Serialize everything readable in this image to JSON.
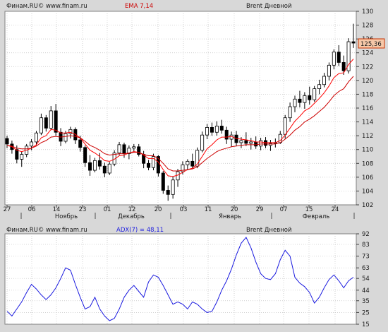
{
  "header_main": {
    "source": "Финам.RU© www.finam.ru",
    "indicator": "EMA 7,14",
    "instrument": "Brent Дневной"
  },
  "header_adx": {
    "source": "Финам.RU© www.finam.ru",
    "indicator": "ADX(7) = 48,11",
    "instrument": "Brent Дневной"
  },
  "last_price_label": "125,36",
  "colors": {
    "background": "#d8d8d8",
    "plot": "#ffffff",
    "ema_fast": "#ff0000",
    "ema_slow": "#cc0000",
    "adx": "#1a1adf",
    "label_bg": "#f6c8a8"
  },
  "chart_data": [
    {
      "type": "candlestick",
      "title": "Brent Дневной",
      "ylim": [
        102,
        130
      ],
      "y_ticks": [
        "102",
        "104",
        "106",
        "108",
        "110",
        "112",
        "114",
        "116",
        "118",
        "120",
        "122",
        "124",
        "126",
        "128",
        "130"
      ],
      "x_day_ticks": [
        "27",
        "06",
        "14",
        "23",
        "01",
        "12",
        "20",
        "03",
        "11",
        "20",
        "29",
        "07",
        "15",
        "24"
      ],
      "x_month_labels": [
        "Ноябрь",
        "Декабрь",
        "Январь",
        "Февраль"
      ],
      "grid": true,
      "ohlc": [
        [
          111.6,
          112.0,
          110.2,
          110.8
        ],
        [
          110.8,
          111.3,
          109.4,
          110.0
        ],
        [
          110.0,
          110.6,
          108.0,
          108.6
        ],
        [
          108.6,
          109.7,
          107.5,
          109.3
        ],
        [
          109.3,
          110.8,
          108.9,
          110.5
        ],
        [
          110.5,
          111.5,
          109.9,
          111.1
        ],
        [
          111.1,
          112.7,
          110.6,
          112.4
        ],
        [
          112.4,
          115.2,
          112.1,
          114.6
        ],
        [
          114.6,
          115.0,
          112.6,
          113.1
        ],
        [
          113.1,
          116.3,
          112.8,
          115.6
        ],
        [
          115.6,
          116.6,
          112.0,
          112.5
        ],
        [
          112.5,
          113.1,
          110.5,
          111.2
        ],
        [
          111.2,
          112.7,
          110.9,
          112.3
        ],
        [
          112.3,
          113.3,
          111.6,
          112.9
        ],
        [
          112.9,
          113.2,
          110.8,
          111.4
        ],
        [
          111.4,
          112.0,
          109.7,
          110.3
        ],
        [
          110.3,
          110.6,
          107.5,
          108.1
        ],
        [
          108.1,
          109.2,
          106.2,
          107.0
        ],
        [
          107.0,
          108.8,
          106.7,
          108.4
        ],
        [
          108.4,
          109.5,
          107.1,
          107.6
        ],
        [
          107.6,
          108.1,
          106.0,
          106.6
        ],
        [
          106.6,
          108.2,
          106.3,
          107.9
        ],
        [
          107.9,
          109.9,
          107.6,
          109.5
        ],
        [
          109.5,
          111.1,
          109.2,
          110.7
        ],
        [
          110.7,
          111.0,
          108.8,
          109.4
        ],
        [
          109.4,
          110.6,
          108.6,
          110.2
        ],
        [
          110.2,
          110.8,
          109.6,
          110.4
        ],
        [
          110.4,
          110.8,
          109.0,
          109.3
        ],
        [
          109.3,
          109.8,
          107.3,
          108.0
        ],
        [
          108.0,
          108.5,
          107.0,
          107.4
        ],
        [
          107.4,
          109.4,
          107.0,
          109.0
        ],
        [
          109.0,
          109.2,
          106.1,
          106.6
        ],
        [
          106.6,
          106.9,
          103.6,
          104.1
        ],
        [
          104.1,
          104.8,
          102.6,
          103.5
        ],
        [
          103.5,
          106.1,
          102.9,
          105.6
        ],
        [
          105.6,
          107.2,
          104.6,
          106.8
        ],
        [
          106.8,
          108.3,
          106.4,
          107.8
        ],
        [
          107.8,
          108.6,
          107.0,
          108.3
        ],
        [
          108.3,
          109.4,
          107.2,
          107.6
        ],
        [
          107.6,
          110.3,
          107.3,
          109.9
        ],
        [
          109.9,
          112.6,
          109.6,
          112.1
        ],
        [
          112.1,
          113.7,
          111.5,
          113.2
        ],
        [
          113.2,
          113.9,
          112.0,
          112.5
        ],
        [
          112.5,
          114.1,
          112.0,
          113.4
        ],
        [
          113.4,
          114.3,
          112.3,
          112.8
        ],
        [
          112.8,
          113.3,
          110.8,
          111.5
        ],
        [
          111.5,
          112.6,
          110.4,
          112.1
        ],
        [
          112.1,
          112.7,
          110.5,
          111.0
        ],
        [
          111.0,
          111.8,
          110.2,
          111.3
        ],
        [
          111.3,
          112.5,
          110.5,
          110.9
        ],
        [
          110.9,
          111.7,
          110.0,
          111.1
        ],
        [
          111.1,
          111.9,
          110.1,
          110.5
        ],
        [
          110.5,
          111.7,
          109.9,
          111.3
        ],
        [
          111.3,
          111.8,
          110.2,
          110.6
        ],
        [
          110.6,
          111.4,
          109.8,
          110.9
        ],
        [
          110.9,
          111.6,
          110.3,
          111.0
        ],
        [
          111.0,
          112.7,
          110.8,
          112.2
        ],
        [
          112.2,
          115.0,
          111.6,
          114.6
        ],
        [
          114.6,
          116.8,
          114.0,
          116.2
        ],
        [
          116.2,
          117.8,
          115.4,
          117.3
        ],
        [
          117.3,
          118.5,
          116.1,
          116.8
        ],
        [
          116.8,
          118.3,
          115.9,
          117.8
        ],
        [
          117.8,
          119.1,
          116.5,
          117.2
        ],
        [
          117.2,
          119.2,
          116.9,
          118.8
        ],
        [
          118.8,
          120.1,
          118.0,
          119.4
        ],
        [
          119.4,
          121.1,
          119.0,
          120.6
        ],
        [
          120.6,
          122.6,
          120.0,
          122.2
        ],
        [
          122.2,
          124.5,
          121.6,
          124.1
        ],
        [
          124.1,
          125.1,
          122.1,
          122.6
        ],
        [
          122.6,
          123.6,
          120.8,
          121.4
        ],
        [
          121.4,
          126.1,
          121.0,
          125.6
        ],
        [
          125.6,
          128.2,
          124.7,
          125.4
        ]
      ],
      "series": [
        {
          "name": "EMA 7",
          "values": [
            110.6,
            110.4,
            109.9,
            109.7,
            109.9,
            110.2,
            110.7,
            111.7,
            112.0,
            112.9,
            112.8,
            112.4,
            112.4,
            112.5,
            112.2,
            111.7,
            110.8,
            109.9,
            109.5,
            109.0,
            108.4,
            108.3,
            108.6,
            109.1,
            109.2,
            109.5,
            109.7,
            109.6,
            109.2,
            108.7,
            108.7,
            108.2,
            107.1,
            106.2,
            106.1,
            106.3,
            106.7,
            107.1,
            107.3,
            107.9,
            109.0,
            110.1,
            110.7,
            111.4,
            111.8,
            111.8,
            111.9,
            111.6,
            111.5,
            111.4,
            111.3,
            111.1,
            111.1,
            111.0,
            111.0,
            111.0,
            111.3,
            112.1,
            113.1,
            114.1,
            114.8,
            115.6,
            116.0,
            116.7,
            117.4,
            118.2,
            119.2,
            120.4,
            121.0,
            121.1,
            122.3,
            123.1
          ]
        },
        {
          "name": "EMA 14",
          "values": [
            110.6,
            110.5,
            110.2,
            110.1,
            110.1,
            110.2,
            110.5,
            111.0,
            111.3,
            111.8,
            111.9,
            111.8,
            111.9,
            112.0,
            111.9,
            111.7,
            111.2,
            110.6,
            110.3,
            109.9,
            109.4,
            109.2,
            109.3,
            109.4,
            109.4,
            109.5,
            109.6,
            109.6,
            109.3,
            109.1,
            109.1,
            108.7,
            108.0,
            107.2,
            106.9,
            106.9,
            107.0,
            107.1,
            107.2,
            107.5,
            108.1,
            108.7,
            109.2,
            109.7,
            110.0,
            110.2,
            110.4,
            110.5,
            110.6,
            110.7,
            110.7,
            110.7,
            110.8,
            110.8,
            110.8,
            110.8,
            111.0,
            111.5,
            112.1,
            112.8,
            113.3,
            114.0,
            114.4,
            114.9,
            115.5,
            116.1,
            116.9,
            117.8,
            118.4,
            118.8,
            119.8,
            120.6
          ]
        }
      ]
    },
    {
      "type": "line",
      "title": "ADX(7) = 48,11",
      "ylim": [
        15,
        92
      ],
      "y_ticks": [
        "15",
        "25",
        "35",
        "44",
        "54",
        "63",
        "73",
        "83",
        "92"
      ],
      "grid": true,
      "series": [
        {
          "name": "ADX(7)",
          "values": [
            26,
            22,
            28,
            34,
            42,
            49,
            45,
            40,
            36,
            40,
            46,
            54,
            63,
            61,
            49,
            38,
            28,
            30,
            38,
            28,
            22,
            18,
            20,
            28,
            38,
            44,
            48,
            43,
            38,
            51,
            57,
            55,
            48,
            40,
            32,
            34,
            32,
            28,
            34,
            32,
            28,
            25,
            26,
            34,
            44,
            52,
            62,
            74,
            84,
            89,
            80,
            68,
            58,
            54,
            53,
            58,
            70,
            78,
            73,
            55,
            50,
            47,
            42,
            33,
            38,
            46,
            53,
            57,
            52,
            46,
            52,
            55
          ]
        }
      ]
    }
  ]
}
